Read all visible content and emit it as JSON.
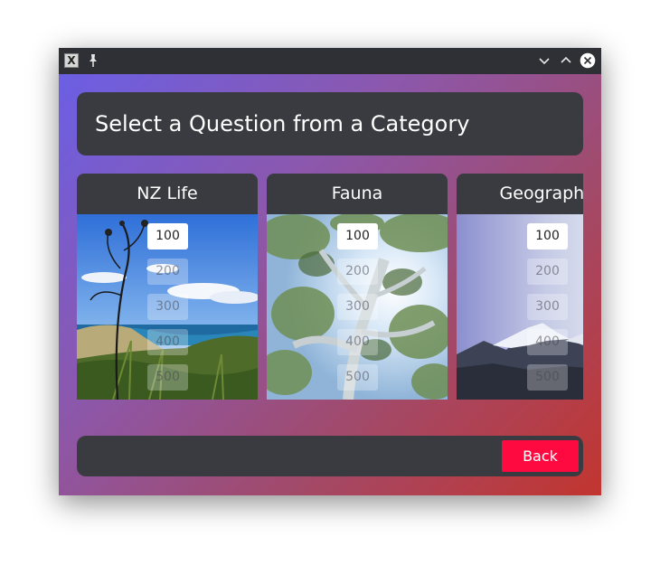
{
  "window": {
    "app_icon_glyph": "X",
    "controls": [
      "minimize-icon",
      "maximize-icon",
      "close-icon"
    ]
  },
  "header": {
    "title": "Select a Question from a Category"
  },
  "categories": [
    {
      "name": "NZ Life",
      "values": [
        "100",
        "200",
        "300",
        "400",
        "500"
      ],
      "available": [
        true,
        false,
        false,
        false,
        false
      ]
    },
    {
      "name": "Fauna",
      "values": [
        "100",
        "200",
        "300",
        "400",
        "500"
      ],
      "available": [
        true,
        false,
        false,
        false,
        false
      ]
    },
    {
      "name": "Geography",
      "values": [
        "100",
        "200",
        "300",
        "400",
        "500"
      ],
      "available": [
        true,
        false,
        false,
        false,
        false
      ]
    }
  ],
  "footer": {
    "back_label": "Back"
  },
  "colors": {
    "accent": "#ff0a40",
    "panel": "#3a3b40",
    "gradient_start": "#6b5fe4",
    "gradient_end": "#c2352f"
  }
}
